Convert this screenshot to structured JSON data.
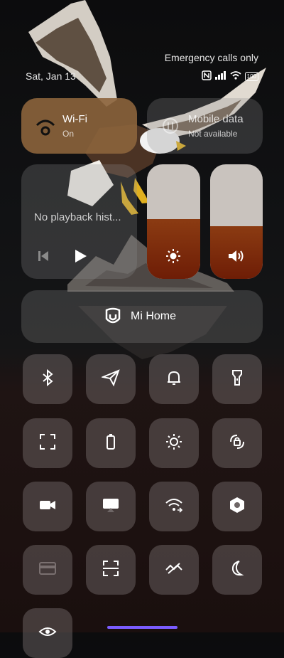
{
  "status": {
    "date": "Sat, Jan 13",
    "carrier_text": "Emergency calls only",
    "battery": "100"
  },
  "tiles": {
    "wifi": {
      "title": "Wi-Fi",
      "subtitle": "On",
      "icon": "wifi-icon"
    },
    "mobile": {
      "title": "Mobile data",
      "subtitle": "Not available",
      "icon": "mobile-data-icon"
    }
  },
  "media": {
    "text": "No playback hist..."
  },
  "brightness": {
    "level": 0.5,
    "icon": "sun-icon"
  },
  "volume": {
    "level": 0.45,
    "icon": "speaker-icon"
  },
  "mihome": {
    "label": "Mi Home",
    "icon": "mi-home-icon"
  },
  "colors": {
    "accent": "#8b3b12",
    "wifi_tile": "#8c643c",
    "handle": "#7a5cff"
  }
}
